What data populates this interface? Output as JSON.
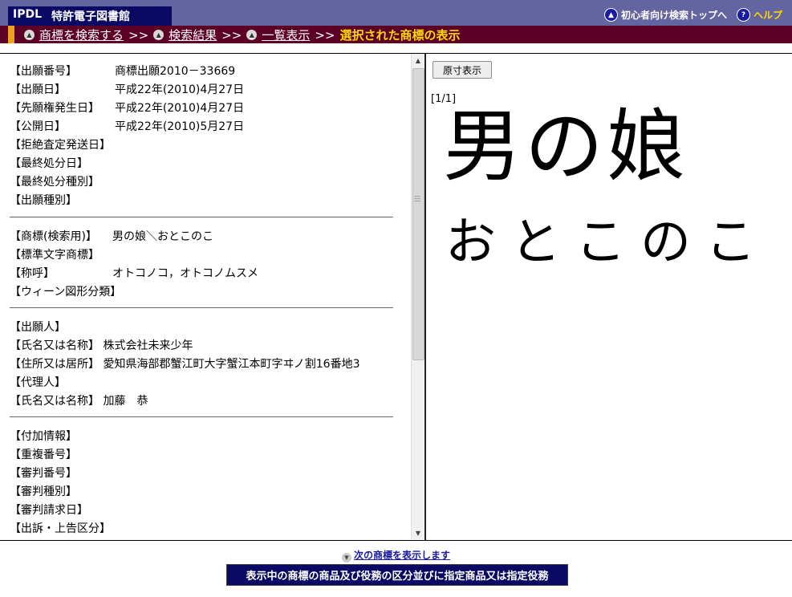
{
  "header": {
    "logo": "IPDL",
    "title": "特許電子図書館",
    "beginner_link": "初心者向け検索トップへ",
    "help_link": "ヘルプ"
  },
  "breadcrumb": {
    "items": [
      "商標を検索する",
      "検索結果",
      "一覧表示"
    ],
    "separator": ">>",
    "current": "選択された商標の表示"
  },
  "details": {
    "section1": [
      {
        "label": "【出願番号】",
        "value": "商標出願2010－33669"
      },
      {
        "label": "【出願日】",
        "value": "平成22年(2010)4月27日"
      },
      {
        "label": "【先願権発生日】",
        "value": "平成22年(2010)4月27日"
      },
      {
        "label": "【公開日】",
        "value": "平成22年(2010)5月27日"
      },
      {
        "label": "【拒絶査定発送日】",
        "value": ""
      },
      {
        "label": "【最終処分日】",
        "value": ""
      },
      {
        "label": "【最終処分種別】",
        "value": ""
      },
      {
        "label": "【出願種別】",
        "value": ""
      }
    ],
    "section2": [
      {
        "label": "【商標(検索用)】",
        "value": "男の娘＼おとこのこ"
      },
      {
        "label": "【標準文字商標】",
        "value": ""
      },
      {
        "label": "【称呼】",
        "value": "オトコノコ，オトコノムスメ"
      },
      {
        "label": "【ウィーン図形分類】",
        "value": ""
      }
    ],
    "section3": [
      {
        "label": "【出願人】",
        "value": ""
      },
      {
        "label": "【氏名又は名称】",
        "value": "株式会社未来少年"
      },
      {
        "label": "【住所又は居所】",
        "value": "愛知県海部郡蟹江町大字蟹江本町字ヰノ割16番地3"
      },
      {
        "label": "【代理人】",
        "value": ""
      },
      {
        "label": "【氏名又は名称】",
        "value": "加藤　恭"
      }
    ],
    "section4": [
      {
        "label": "【付加情報】",
        "value": ""
      },
      {
        "label": "【重複番号】",
        "value": ""
      },
      {
        "label": "【審判番号】",
        "value": ""
      },
      {
        "label": "【審判種別】",
        "value": ""
      },
      {
        "label": "【審判請求日】",
        "value": ""
      },
      {
        "label": "【出訴・上告区分】",
        "value": ""
      }
    ]
  },
  "image_panel": {
    "original_size_button": "原寸表示",
    "page_count": "[1/1]",
    "mark_main": "男の娘",
    "mark_reading": "おとこのこ"
  },
  "footer": {
    "next_link": "次の商標を表示します",
    "goods_button": "表示中の商標の商品及び役務の区分並びに指定商品又は指定役務"
  },
  "colors": {
    "header_blue": "#6464a0",
    "logo_navy": "#0a0a64",
    "breadcrumb_maroon": "#5c0026",
    "accent_orange": "#f0a020",
    "current_yellow": "#ffd800"
  }
}
